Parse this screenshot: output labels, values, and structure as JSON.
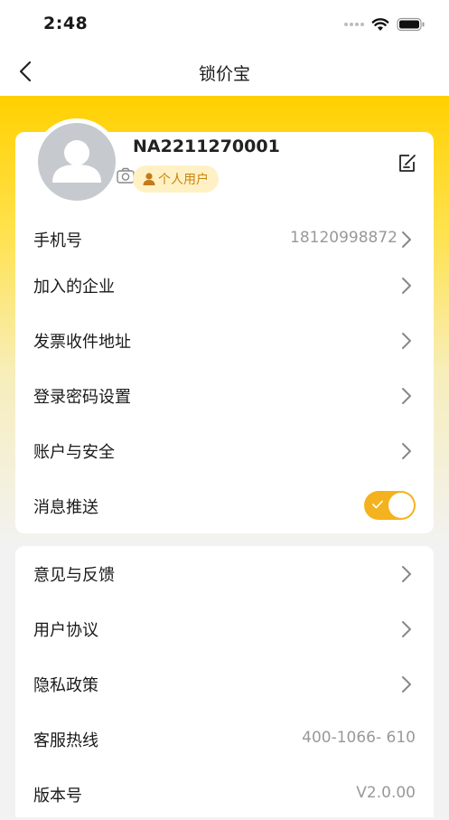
{
  "status_bar": {
    "time": "2:48"
  },
  "nav": {
    "title": "锁价宝"
  },
  "profile": {
    "user_id": "NA2211270001",
    "badge_label": "个人用户"
  },
  "settings_group_1": [
    {
      "label": "手机号",
      "value": "18120998872"
    },
    {
      "label": "加入的企业"
    },
    {
      "label": "发票收件地址"
    },
    {
      "label": "登录密码设置"
    },
    {
      "label": "账户与安全"
    },
    {
      "label": "消息推送",
      "toggle_on": true
    }
  ],
  "settings_group_2": [
    {
      "label": "意见与反馈"
    },
    {
      "label": "用户协议"
    },
    {
      "label": "隐私政策"
    },
    {
      "label": "客服热线",
      "value": "400-1066- 610"
    },
    {
      "label": "版本号",
      "value": "V2.0.00"
    }
  ],
  "colors": {
    "accent_yellow": "#ffd000",
    "toggle_on": "#f5b21f",
    "badge_bg": "#fff1c4",
    "badge_text": "#c9830c"
  },
  "icons": [
    "back-icon",
    "camera-icon",
    "edit-icon",
    "person-icon",
    "chevron-right-icon",
    "check-icon",
    "wifi-icon",
    "battery-icon"
  ]
}
